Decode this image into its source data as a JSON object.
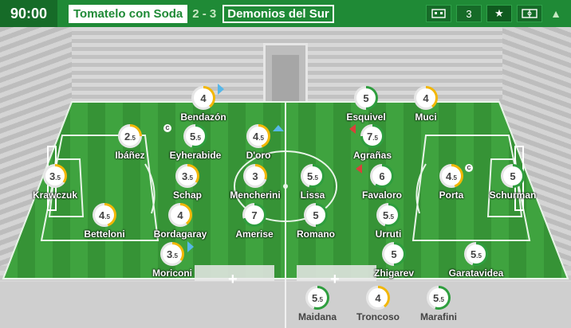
{
  "match": {
    "clock": "90:00",
    "home_team": "Tomatelo con Soda",
    "score": "2 - 3",
    "away_team": "Demonios del Sur"
  },
  "toolbar": {
    "icons": [
      "formation-board-icon",
      "shirt-number-icon",
      "star-icon",
      "pitch-icon",
      "chevron-up-icon"
    ],
    "shirt_label": "3",
    "star_label": "★"
  },
  "bench_add_label": "+",
  "players": [
    {
      "name": "Bendazón",
      "rating": "4",
      "side": "home"
    },
    {
      "name": "Ibáñez",
      "rating": "2.5",
      "side": "home"
    },
    {
      "name": "Eyherabide",
      "rating": "5.5",
      "side": "home"
    },
    {
      "name": "D'oro",
      "rating": "4.5",
      "side": "home"
    },
    {
      "name": "Krawczuk",
      "rating": "3.5",
      "side": "home"
    },
    {
      "name": "Schap",
      "rating": "3.5",
      "side": "home"
    },
    {
      "name": "Mencherini",
      "rating": "3",
      "side": "home"
    },
    {
      "name": "Betteloni",
      "rating": "4.5",
      "side": "home"
    },
    {
      "name": "Bordagaray",
      "rating": "4",
      "side": "home"
    },
    {
      "name": "Amerise",
      "rating": "7",
      "side": "home"
    },
    {
      "name": "Moriconi",
      "rating": "3.5",
      "side": "home"
    },
    {
      "name": "Esquivel",
      "rating": "5",
      "side": "away"
    },
    {
      "name": "Muci",
      "rating": "4",
      "side": "away"
    },
    {
      "name": "Agrañas",
      "rating": "7.5",
      "side": "away"
    },
    {
      "name": "Lissa",
      "rating": "5.5",
      "side": "away"
    },
    {
      "name": "Favaloro",
      "rating": "6",
      "side": "away"
    },
    {
      "name": "Porta",
      "rating": "4.5",
      "side": "away"
    },
    {
      "name": "Schurman",
      "rating": "5",
      "side": "away"
    },
    {
      "name": "Romano",
      "rating": "5",
      "side": "away"
    },
    {
      "name": "Urruti",
      "rating": "5.5",
      "side": "away"
    },
    {
      "name": "Zhigarev",
      "rating": "5",
      "side": "away"
    },
    {
      "name": "Garatavidea",
      "rating": "5.5",
      "side": "away"
    }
  ],
  "bench": [
    {
      "name": "Maidana",
      "rating": "5.5"
    },
    {
      "name": "Troncoso",
      "rating": "4"
    },
    {
      "name": "Marafini",
      "rating": "5.5"
    }
  ],
  "colors": {
    "header_green": "#1f8a36",
    "pitch_light": "#3fa33f",
    "pitch_dark": "#358f35",
    "rating_low": "#f2b705",
    "rating_high": "#2e9e3e"
  }
}
